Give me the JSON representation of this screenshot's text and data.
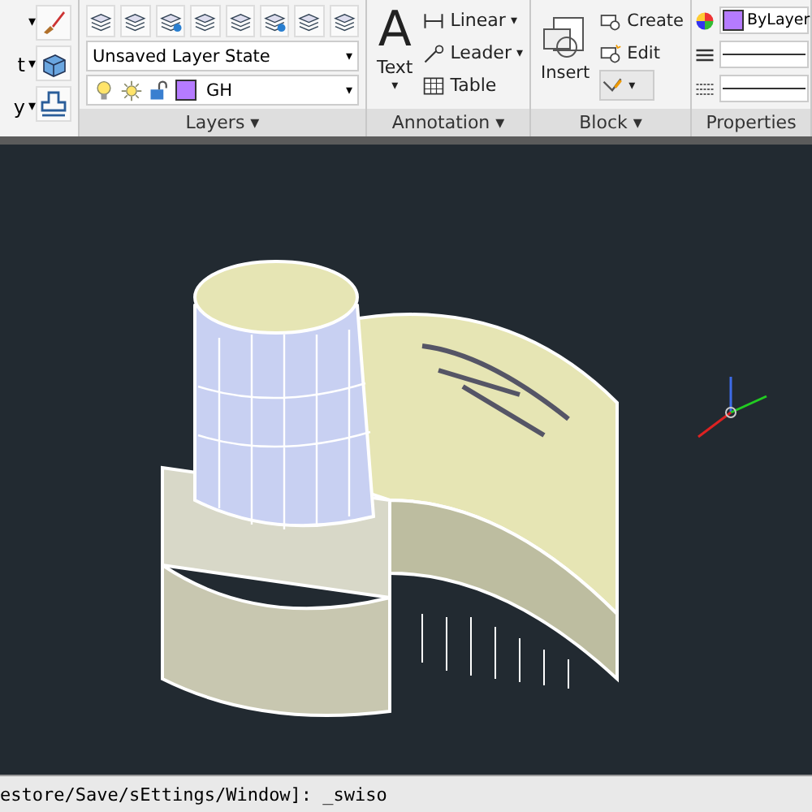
{
  "ribbon": {
    "left_panel": {
      "rows": [
        {
          "label": "",
          "caret": "▾"
        },
        {
          "label": "t",
          "caret": "▾"
        },
        {
          "label": "y",
          "caret": "▾"
        }
      ]
    },
    "layers": {
      "title": "Layers",
      "caret": "▾",
      "layer_state": "Unsaved Layer State",
      "current_layer": {
        "name": "GH",
        "color": "#b57bff",
        "on": true,
        "frozen": false,
        "locked": false
      },
      "dropdown_caret": "▾"
    },
    "annotation": {
      "title": "Annotation",
      "caret": "▾",
      "text_glyph": "A",
      "text_button": "Text",
      "text_caret": "▾",
      "items": [
        {
          "kind": "linear",
          "label": "Linear",
          "caret": "▾"
        },
        {
          "kind": "leader",
          "label": "Leader",
          "caret": "▾"
        },
        {
          "kind": "table",
          "label": "Table"
        }
      ]
    },
    "block": {
      "title": "Block",
      "caret": "▾",
      "insert": "Insert",
      "items": [
        {
          "kind": "create",
          "label": "Create"
        },
        {
          "kind": "edit",
          "label": "Edit"
        }
      ],
      "attribute_caret": "▾"
    },
    "properties": {
      "title": "Properties",
      "color_label": "ByLayer",
      "color": "#b57bff"
    }
  },
  "command_line": {
    "text": "estore/Save/sEttings/Window]: _swiso"
  }
}
